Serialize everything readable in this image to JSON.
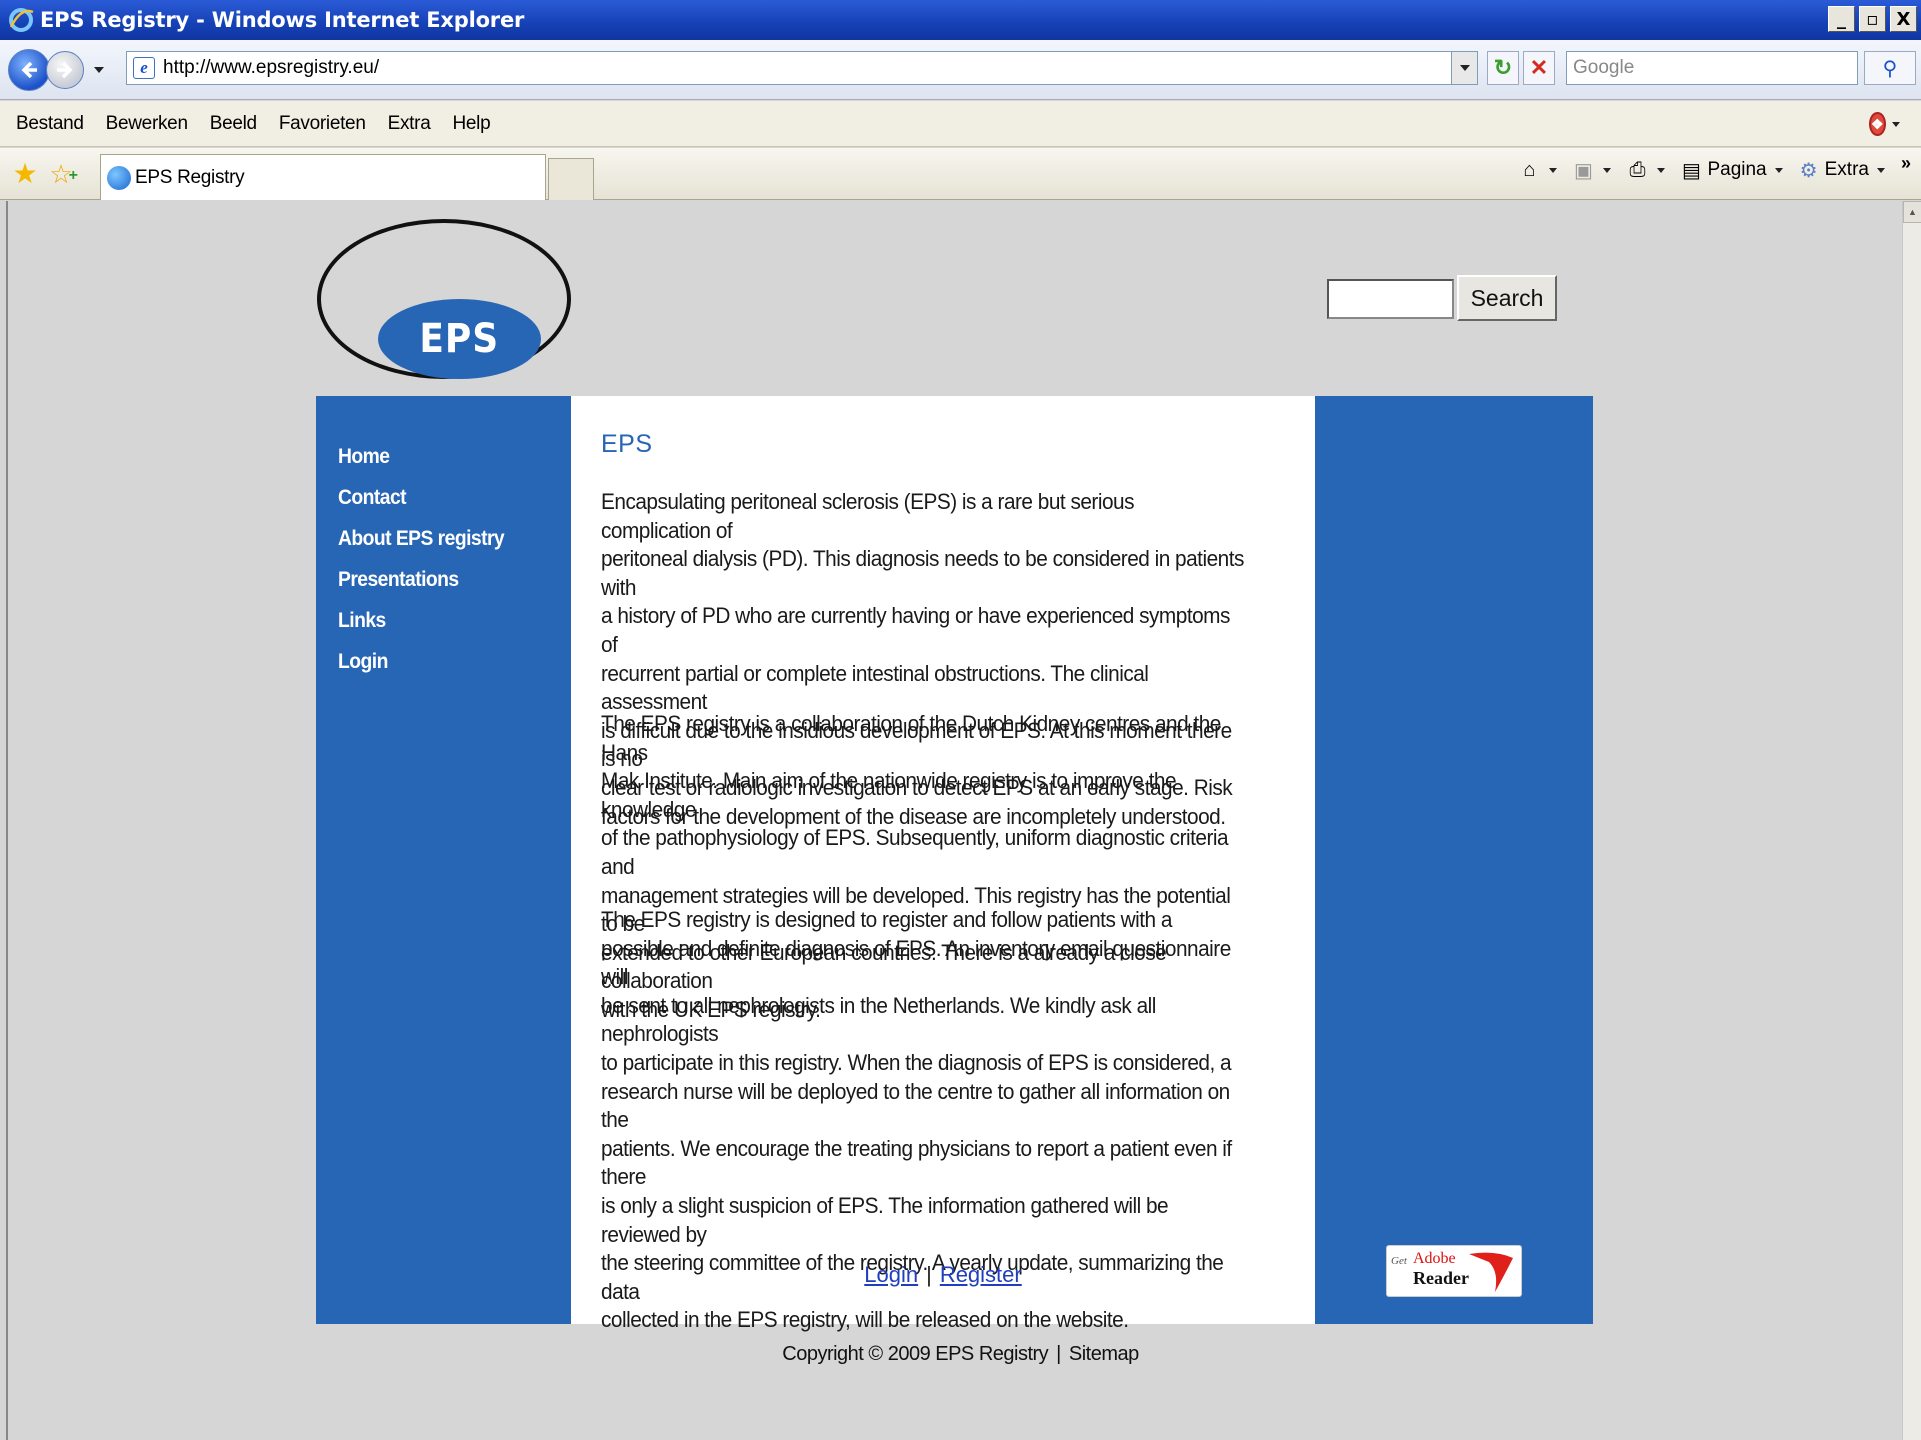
{
  "window": {
    "title": "EPS Registry - Windows Internet Explorer",
    "controls": [
      "_",
      "▫",
      "X"
    ]
  },
  "address_bar": {
    "url": "http://www.epsregistry.eu/",
    "search_placeholder": "Google"
  },
  "menu": {
    "items": [
      "Bestand",
      "Bewerken",
      "Beeld",
      "Favorieten",
      "Extra",
      "Help"
    ]
  },
  "tab": {
    "label": "EPS Registry"
  },
  "command_bar": {
    "page_label": "Pagina",
    "tools_label": "Extra"
  },
  "site": {
    "logo_text": "EPS",
    "search_button": "Search",
    "nav": [
      "Home",
      "Contact",
      "About EPS registry",
      "Presentations",
      "Links",
      "Login"
    ],
    "heading": "EPS",
    "paragraphs": [
      "Encapsulating peritoneal sclerosis (EPS) is a rare but serious complication of\nperitoneal dialysis (PD). This diagnosis needs to be considered in patients with\na history of PD who are currently having or have experienced symptoms of\nrecurrent partial or complete intestinal obstructions. The clinical assessment\nis difficult due to the insidious development of EPS. At this moment there is no\nclear test or radiologic investigation to detect EPS at an early stage. Risk\nfactors for the development of the disease are incompletely understood.",
      "The EPS registry is a collaboration of the Dutch Kidney centres and the Hans\nMak Institute. Main aim of the nationwide registry is to improve the knowledge\nof the pathophysiology of EPS. Subsequently, uniform diagnostic criteria and\nmanagement strategies will be developed. This registry has the potential to be\nextended to other European countries. There is a already a close collaboration\nwith the UK EPS registry.",
      "The EPS registry is designed to register and follow patients with a\npossible and definite diagnosis of EPS. An inventory email questionnaire will\nbe sent to all nephrologists in the Netherlands. We kindly ask all nephrologists\nto participate in this registry. When the diagnosis of EPS is considered,   a\nresearch nurse will be deployed to the centre to gather all information on the\npatients. We encourage the treating physicians to report a patient even if there\nis only a slight suspicion of EPS. The information gathered will be reviewed by\nthe steering committee of the registry. A yearly update, summarizing the data\ncollected in the EPS registry, will be released on the website."
    ],
    "login_link": "Login",
    "register_link": "Register",
    "link_separator": "|",
    "adobe_badge": {
      "get": "Get",
      "adobe": "Adobe",
      "reader": "Reader"
    },
    "footer": {
      "copyright": "Copyright © 2009 EPS Registry",
      "separator": "|",
      "sitemap": "Sitemap"
    }
  },
  "colors": {
    "site_blue": "#2765b5",
    "titlebar_blue": "#1641b5",
    "page_background": "#d6d6d6",
    "link_blue": "#1f3fbf"
  },
  "icons": [
    "ie-logo-icon",
    "back-arrow-icon",
    "forward-arrow-icon",
    "page-icon",
    "refresh-icon",
    "stop-icon",
    "search-icon",
    "translate-icon",
    "favorites-star-icon",
    "add-favorite-icon",
    "home-icon",
    "feeds-icon",
    "print-icon",
    "page-menu-icon",
    "tools-gear-icon"
  ]
}
